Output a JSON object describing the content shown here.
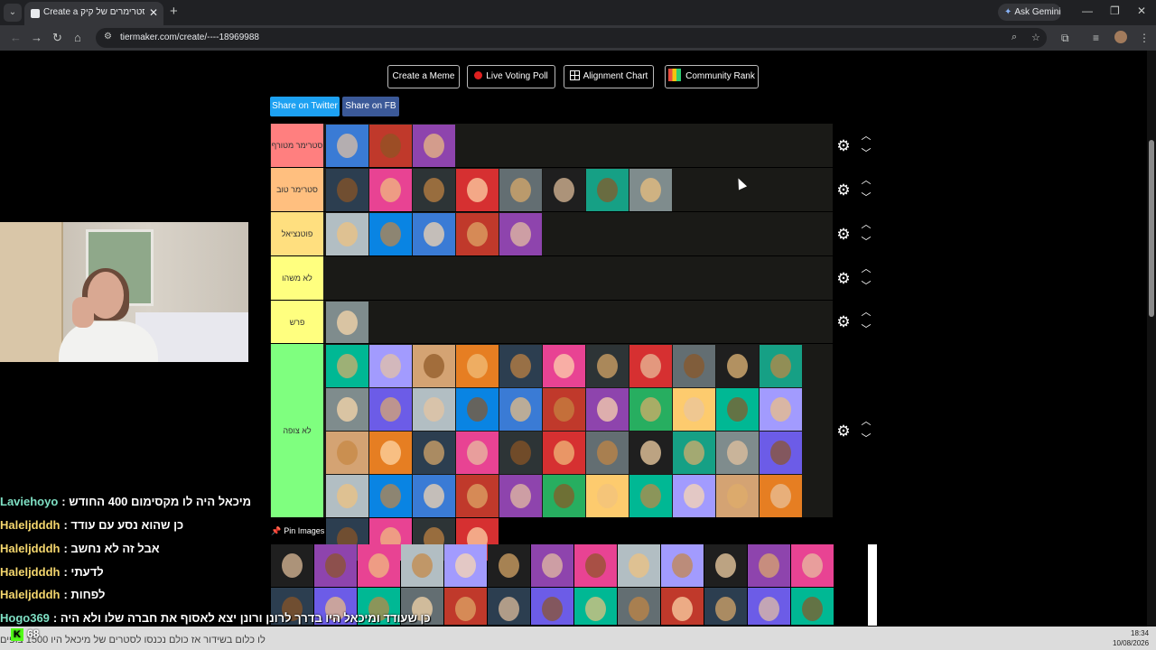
{
  "browser": {
    "tab_title": "Create a דירוג סטרימרים של קיק",
    "new_tab_glyph": "+",
    "close_glyph": "✕",
    "ask_gemini": "Ask Gemini",
    "url": "tiermaker.com/create/----18969988",
    "window_min": "—",
    "window_restore": "❐",
    "window_close": "✕"
  },
  "toolbar": {
    "create_meme": "Create a Meme",
    "live_voting_poll": "Live Voting Poll",
    "alignment_chart": "Alignment Chart",
    "community_rank": "Community Rank"
  },
  "share": {
    "twitter": "Share on Twitter",
    "fb": "Share on FB",
    "twitter_color": "#1da1f2",
    "fb_color": "#3b5998"
  },
  "tiers": [
    {
      "label": "סטרימר מטורף",
      "color": "#ff7f7f",
      "items": 3
    },
    {
      "label": "סטרימר טוב",
      "color": "#ffbf7f",
      "items": 8
    },
    {
      "label": "פוטנציאל",
      "color": "#ffdf7f",
      "items": 5
    },
    {
      "label": "לא משהו",
      "color": "#ffff7f",
      "items": 0
    },
    {
      "label": "פרש",
      "color": "#ffff7f",
      "items": 1
    },
    {
      "label": "לא צופה",
      "color": "#7fff7f",
      "items": 48
    }
  ],
  "tier_controls": {
    "settings_glyph": "⚙",
    "up_glyph": "︿",
    "down_glyph": "﹀"
  },
  "pool": {
    "title": "Pin Images",
    "pin_glyph": "📌"
  },
  "chat": [
    {
      "user": "Laviehoyo",
      "text": ": מיכאל היה לו מקסימום 400 החודש",
      "cyan": true
    },
    {
      "user": "Haleljdddh",
      "text": ": כן שהוא נסע עם עודד",
      "cyan": false
    },
    {
      "user": "Haleljdddh",
      "text": ": אבל זה לא נחשב",
      "cyan": false
    },
    {
      "user": "Haleljdddh",
      "text": ": לדעתי",
      "cyan": false
    },
    {
      "user": "Haleljdddh",
      "text": ": לפחות",
      "cyan": false
    },
    {
      "user": "Hogo369",
      "text": ": כן שעודד ומיכאל היו בדרך לרונן ורונן יצא לאסוף את חברה שלו ולא היה",
      "cyan": true
    }
  ],
  "ticker": "לו כלום בשידור אז כולם נכנסו לסטרים של מיכאל היו 1500 צופים",
  "viewers": {
    "badge": "K",
    "count": "68"
  },
  "clock": {
    "time": "18:34",
    "date": "10/08/2026"
  }
}
